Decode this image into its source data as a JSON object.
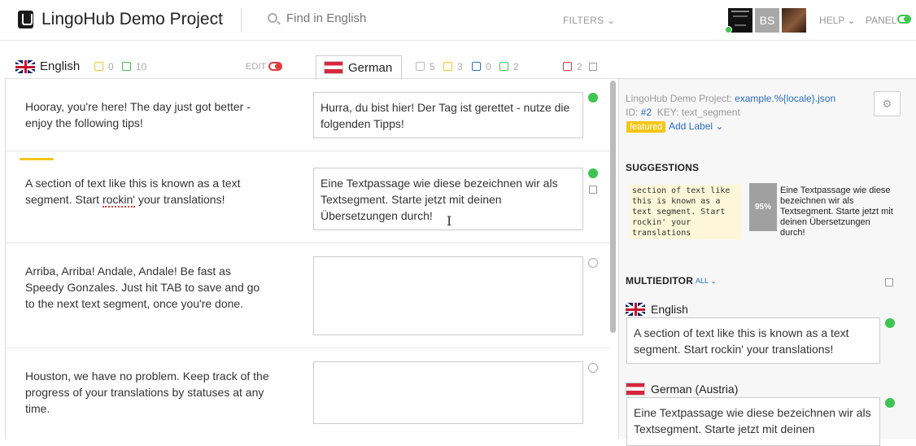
{
  "app": {
    "project_title": "LingoHub Demo Project",
    "search_placeholder": "Find in English ...",
    "filters_label": "FILTERS",
    "avatar_initials": "BS",
    "help_label": "HELP",
    "panel_label": "PANEL"
  },
  "source_lang": {
    "name": "English",
    "count_yellow": "0",
    "count_green": "10",
    "edit_label": "EDIT"
  },
  "target_lang": {
    "name": "German",
    "count_gray": "5",
    "count_yellow": "3",
    "count_blue": "0",
    "count_green": "2",
    "count_red": "2"
  },
  "segments": [
    {
      "source": "Hooray, you're here! The day just got better - enjoy the following tips!",
      "target": "Hurra, du bist hier! Der Tag ist gerettet - nutze die folgenden Tipps!",
      "status": "done"
    },
    {
      "source_pre": "A section of text like this is known as a text segment. Start ",
      "source_spell": "rockin'",
      "source_post": " your translations!",
      "target": "Eine Textpassage wie diese bezeichnen wir als Textsegment. Starte jetzt mit deinen Übersetzungen durch!",
      "status": "done"
    },
    {
      "source": "Arriba, Arriba! Andale, Andale! Be fast as Speedy Gonzales. Just hit TAB to save and go to the next text segment, once you're done.",
      "target": "",
      "status": "empty"
    },
    {
      "source": "Houston, we have no problem. Keep track of the progress of your translations by statuses at any time.",
      "target": "",
      "status": "empty"
    }
  ],
  "panel": {
    "project_prefix": "LingoHub Demo Project:",
    "file_link": "example.%{locale}.json",
    "id_prefix": "ID:",
    "id_value": "#2",
    "key_text": "KEY: text_segment",
    "featured_tag": "featured",
    "add_label": "Add Label",
    "suggestions_title": "SUGGESTIONS",
    "suggestion": {
      "source": "section of text like this is known as a text segment. Start rockin' your translations",
      "match": "95%",
      "target": "Eine Textpassage wie diese bezeichnen wir als Textsegment. Starte jetzt mit deinen Übersetzungen durch!"
    },
    "multieditor_title": "MULTIEDITOR",
    "all_label": "ALL",
    "entries": [
      {
        "lang": "English",
        "text": "A section of text like this is known as a text segment. Start rockin' your translations!"
      },
      {
        "lang": "German (Austria)",
        "text": "Eine Textpassage wie diese bezeichnen wir als Textsegment. Starte jetzt mit deinen"
      }
    ]
  },
  "colors": {
    "accent_green": "#3ec450",
    "accent_red": "#e03a3a",
    "accent_yellow": "#f5c518",
    "link_blue": "#2a6ebb"
  }
}
